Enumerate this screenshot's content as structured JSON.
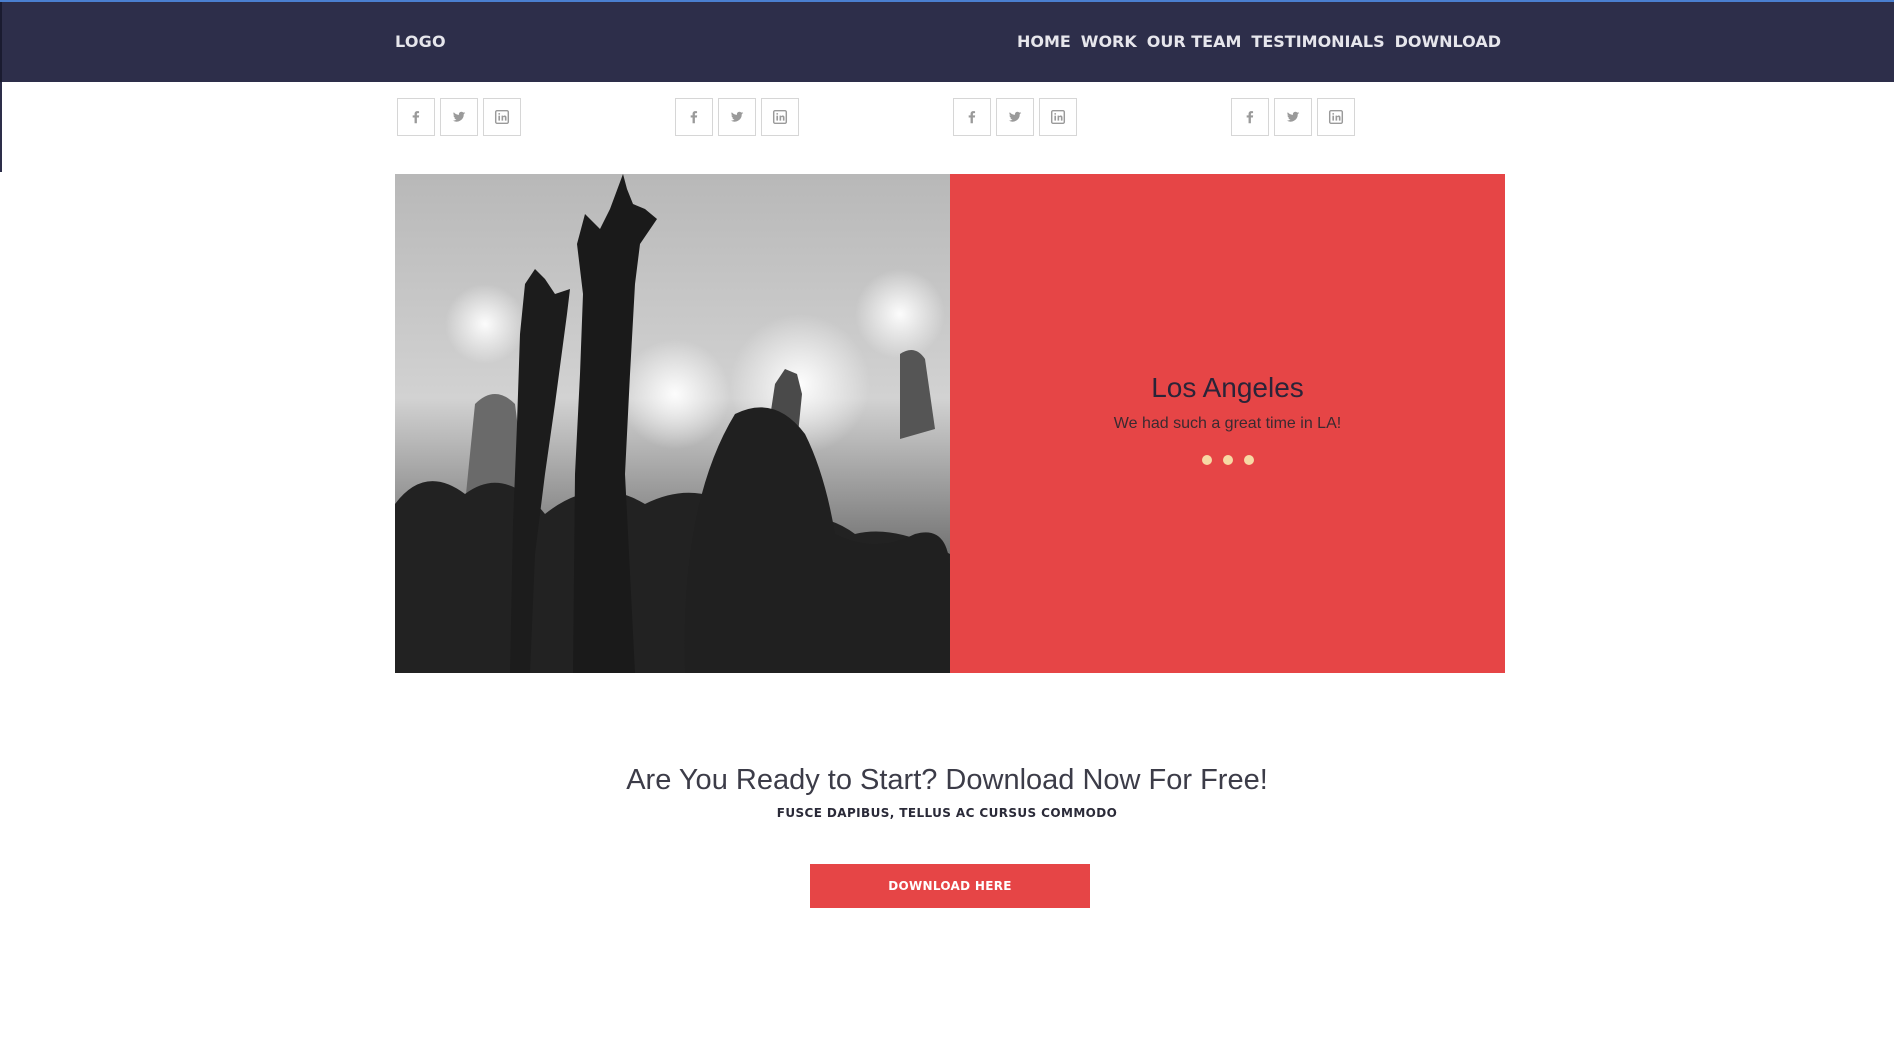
{
  "header": {
    "logo": "LOGO",
    "nav": [
      "HOME",
      "WORK",
      "OUR TEAM",
      "TESTIMONIALS",
      "DOWNLOAD"
    ]
  },
  "social_groups": [
    [
      "facebook-icon",
      "twitter-icon",
      "linkedin-icon"
    ],
    [
      "facebook-icon",
      "twitter-icon",
      "linkedin-icon"
    ],
    [
      "facebook-icon",
      "twitter-icon",
      "linkedin-icon"
    ],
    [
      "facebook-icon",
      "twitter-icon",
      "linkedin-icon"
    ]
  ],
  "slide": {
    "title": "Los Angeles",
    "caption": "We had such a great time in LA!",
    "dot_count": 3
  },
  "cta": {
    "title": "Are You Ready to Start? Download Now For Free!",
    "subtitle": "FUSCE DAPIBUS, TELLUS AC CURSUS COMMODO",
    "button": "DOWNLOAD HERE"
  },
  "colors": {
    "navbar": "#2d2e4a",
    "accent_red": "#e64546",
    "dot": "#f7d9a4"
  }
}
